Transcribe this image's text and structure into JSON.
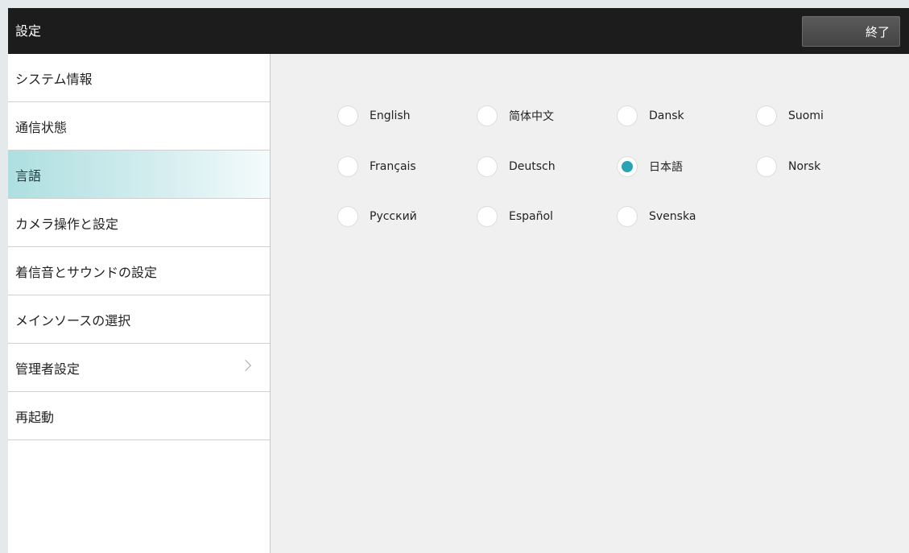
{
  "header": {
    "title": "設定",
    "exit_label": "終了"
  },
  "sidebar": {
    "items": [
      {
        "label": "システム情報",
        "active": false
      },
      {
        "label": "通信状態",
        "active": false
      },
      {
        "label": "言語",
        "active": true
      },
      {
        "label": "カメラ操作と設定",
        "active": false
      },
      {
        "label": "着信音とサウンドの設定",
        "active": false
      },
      {
        "label": "メインソースの選択",
        "active": false
      },
      {
        "label": "管理者設定",
        "active": false,
        "has_chevron": true
      },
      {
        "label": "再起動",
        "active": false
      }
    ]
  },
  "languages": {
    "selected": "日本語",
    "options": [
      "English",
      "简体中文",
      "Dansk",
      "Suomi",
      "Français",
      "Deutsch",
      "日本語",
      "Norsk",
      "Русский",
      "Español",
      "Svenska"
    ]
  },
  "colors": {
    "header_bg": "#1c1c1c",
    "accent": "#2aa3b4",
    "active_item_bg": "#aedfe0",
    "content_bg": "#f0f0f0"
  },
  "icons": {
    "submenu": "chevron-right-icon",
    "radio_on": "radio-selected-icon",
    "radio_off": "radio-unselected-icon"
  }
}
